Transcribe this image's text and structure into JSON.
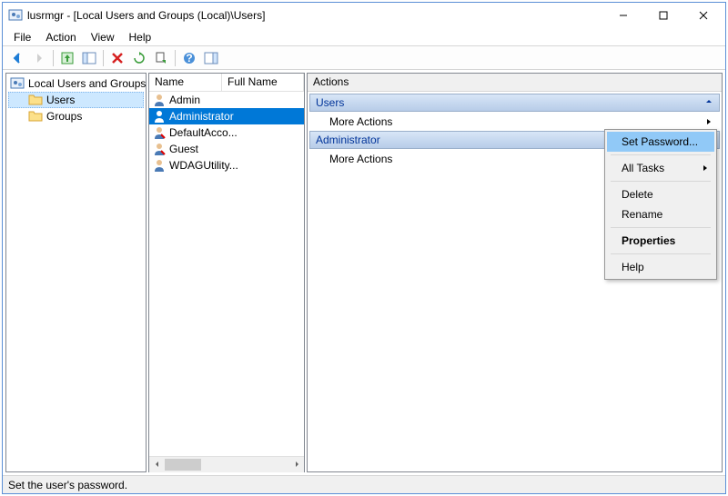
{
  "window": {
    "title": "lusrmgr - [Local Users and Groups (Local)\\Users]"
  },
  "menubar": {
    "file": "File",
    "action": "Action",
    "view": "View",
    "help": "Help"
  },
  "tree": {
    "root": "Local Users and Groups (Local)",
    "users": "Users",
    "groups": "Groups"
  },
  "list": {
    "col_name": "Name",
    "col_fullname": "Full Name",
    "rows": [
      {
        "name": "Admin"
      },
      {
        "name": "Administrator"
      },
      {
        "name": "DefaultAcco..."
      },
      {
        "name": "Guest"
      },
      {
        "name": "WDAGUtility..."
      }
    ]
  },
  "actions": {
    "header": "Actions",
    "section_users": "Users",
    "section_admin": "Administrator",
    "more_actions": "More Actions"
  },
  "context": {
    "set_password": "Set Password...",
    "all_tasks": "All Tasks",
    "delete": "Delete",
    "rename": "Rename",
    "properties": "Properties",
    "help": "Help"
  },
  "statusbar": {
    "text": "Set the user's password."
  }
}
